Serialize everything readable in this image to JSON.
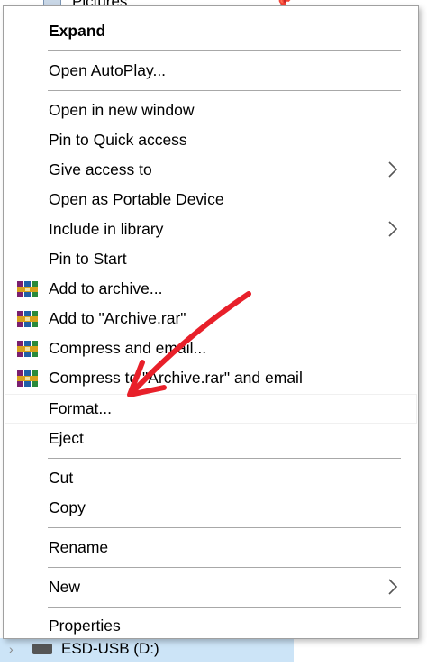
{
  "background": {
    "folder_label": "Pictures",
    "drive_label": "ESD-USB (D:)"
  },
  "menu": {
    "items": [
      {
        "label": "Expand",
        "bold": true
      },
      {
        "label": "Open AutoPlay..."
      },
      {
        "label": "Open in new window"
      },
      {
        "label": "Pin to Quick access"
      },
      {
        "label": "Give access to",
        "submenu": true
      },
      {
        "label": "Open as Portable Device"
      },
      {
        "label": "Include in library",
        "submenu": true
      },
      {
        "label": "Pin to Start"
      },
      {
        "label": "Add to archive...",
        "icon": "winrar-icon"
      },
      {
        "label": "Add to \"Archive.rar\"",
        "icon": "winrar-icon"
      },
      {
        "label": "Compress and email...",
        "icon": "winrar-icon"
      },
      {
        "label": "Compress to \"Archive.rar\" and email",
        "icon": "winrar-icon"
      },
      {
        "label": "Format...",
        "highlighted": true
      },
      {
        "label": "Eject"
      },
      {
        "label": "Cut"
      },
      {
        "label": "Copy"
      },
      {
        "label": "Rename"
      },
      {
        "label": "New",
        "submenu": true
      },
      {
        "label": "Properties"
      }
    ]
  },
  "annotation": {
    "arrow_color": "#e8202a",
    "points_to": "Format..."
  }
}
